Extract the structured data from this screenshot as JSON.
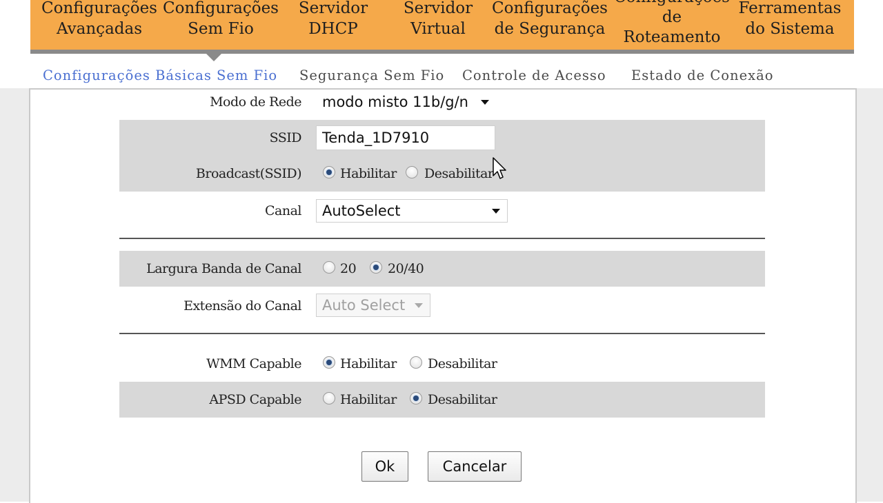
{
  "top_nav": [
    {
      "line1": "Configurações",
      "line2": "Avançadas"
    },
    {
      "line1": "Configurações",
      "line2": "Sem Fio"
    },
    {
      "line1": "Servidor",
      "line2": "DHCP"
    },
    {
      "line1": "Servidor",
      "line2": "Virtual"
    },
    {
      "line1": "Configurações",
      "line2": "de Segurança"
    },
    {
      "line1": "Configurações",
      "line2": "de",
      "line3": "Roteamento"
    },
    {
      "line1": "Ferramentas",
      "line2": "do Sistema"
    }
  ],
  "sub_tabs": [
    "Configurações Básicas Sem Fio",
    "Segurança Sem Fio",
    "Controle de Acesso",
    "Estado de Conexão"
  ],
  "form": {
    "network_mode": {
      "label": "Modo de Rede",
      "value": "modo misto 11b/g/n"
    },
    "ssid": {
      "label": "SSID",
      "value": "Tenda_1D7910"
    },
    "broadcast": {
      "label": "Broadcast(SSID)",
      "option_on": "Habilitar",
      "option_off": "Desabilitar",
      "selected": "Habilitar"
    },
    "channel": {
      "label": "Canal",
      "value": "AutoSelect"
    },
    "bandwidth": {
      "label": "Largura Banda de Canal",
      "option_a": "20",
      "option_b": "20/40",
      "selected": "20/40"
    },
    "extension": {
      "label": "Extensão do Canal",
      "value": "Auto Select"
    },
    "wmm": {
      "label": "WMM Capable",
      "option_on": "Habilitar",
      "option_off": "Desabilitar",
      "selected": "Habilitar"
    },
    "apsd": {
      "label": "APSD Capable",
      "option_on": "Habilitar",
      "option_off": "Desabilitar",
      "selected": "Desabilitar"
    }
  },
  "buttons": {
    "ok": "Ok",
    "cancel": "Cancelar"
  },
  "colors": {
    "nav_bg": "#f5a94a",
    "active_tab": "#4a6fd1",
    "row_shade": "#d8d8d8"
  }
}
